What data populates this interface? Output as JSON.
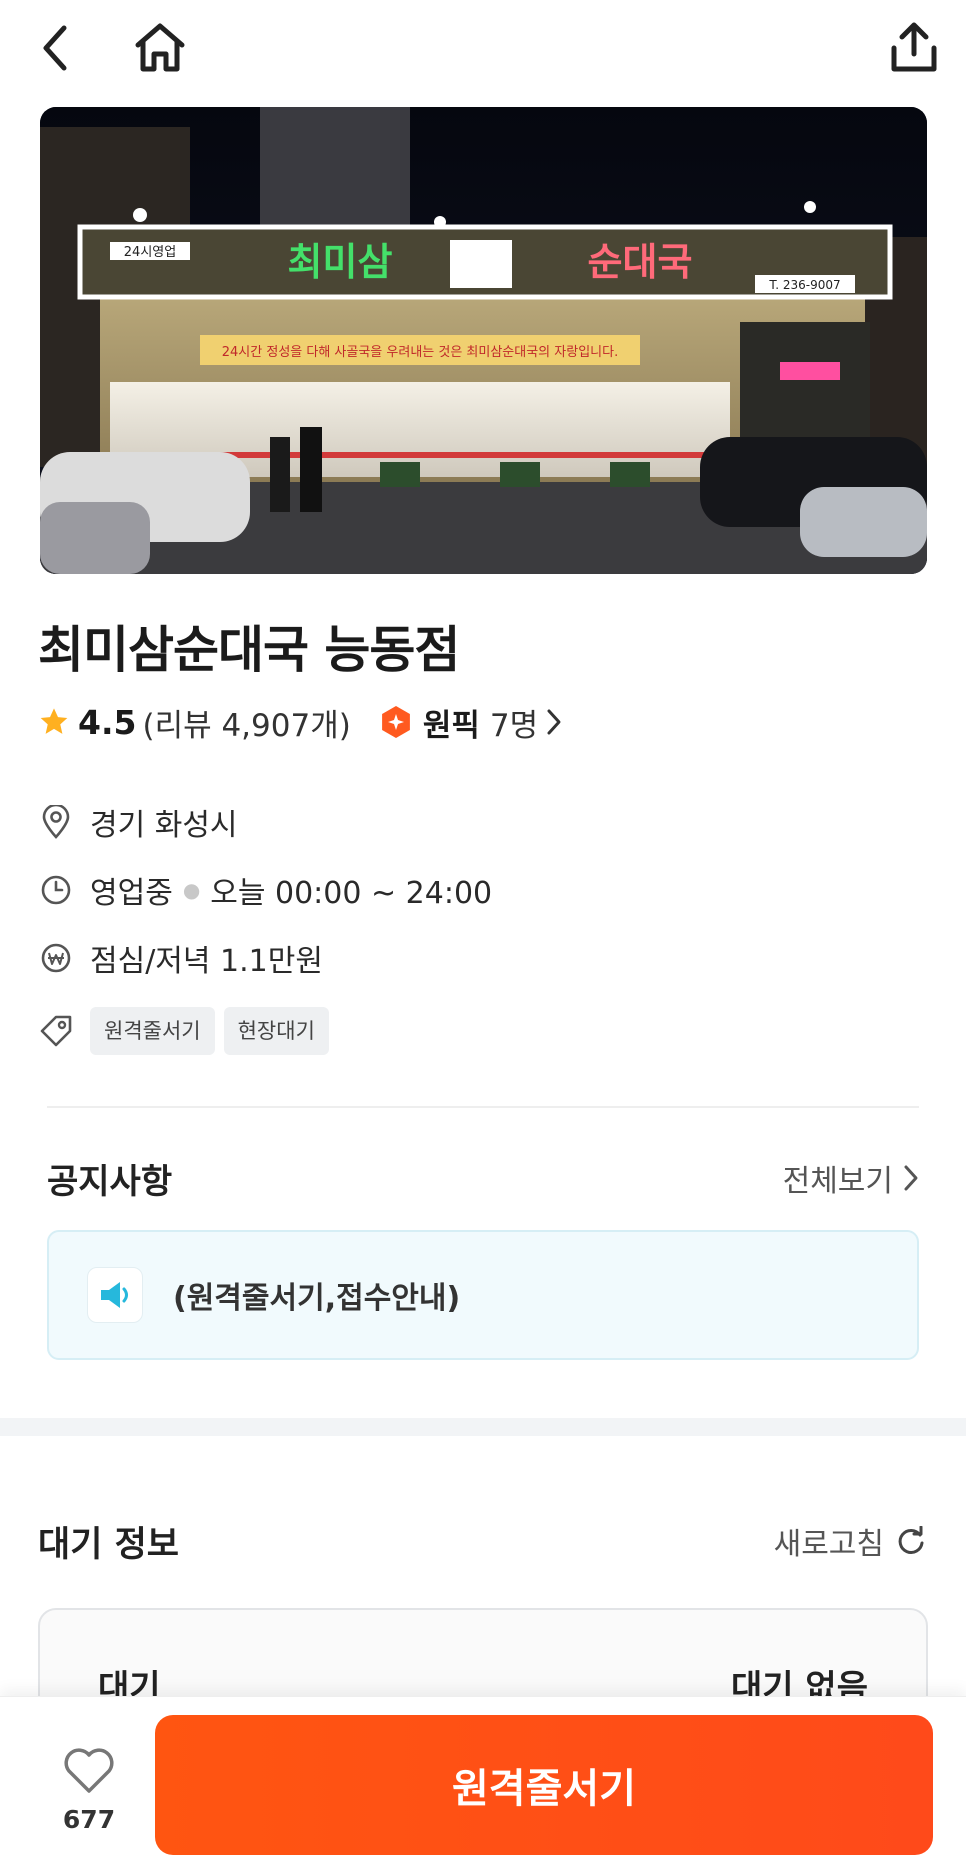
{
  "nav": {
    "back_icon": "chevron-left-icon",
    "home_icon": "home-icon",
    "share_icon": "share-icon"
  },
  "hero": {
    "sign_main_left": "최미삼",
    "sign_main_right": "순대국",
    "sign_hours": "24시영업",
    "sign_phone": "T. 236-9007",
    "banner": "24시간 정성을 다해 사골국을 우려내는 것은 최미삼순대국의 자랑입니다."
  },
  "store": {
    "name": "최미삼순대국 능동점",
    "rating": "4.5",
    "review_count": "(리뷰 4,907개)",
    "wonpick_label": "원픽",
    "wonpick_count": "7명",
    "location": "경기 화성시",
    "status": "영업중",
    "hours": "오늘 00:00 ~ 24:00",
    "price": "점심/저녁 1.1만원",
    "tags": [
      "원격줄서기",
      "현장대기"
    ]
  },
  "notice": {
    "title": "공지사항",
    "see_all": "전체보기",
    "text": "(원격줄서기,접수안내)"
  },
  "wait_info": {
    "title": "대기 정보",
    "refresh_label": "새로고침",
    "label": "대기",
    "value": "대기 없음"
  },
  "bottom": {
    "like_count": "677",
    "cta_label": "원격줄서기"
  },
  "colors": {
    "accent": "#ff5011",
    "star": "#ffb020",
    "notice_bg": "#f1fafd",
    "speaker": "#26b8dc"
  }
}
